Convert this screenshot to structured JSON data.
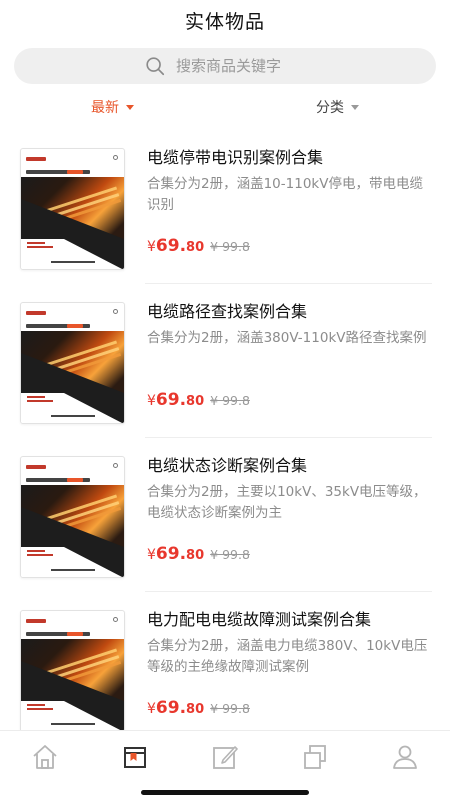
{
  "header": {
    "title": "实体物品"
  },
  "search": {
    "placeholder": "搜索商品关键字"
  },
  "filters": {
    "latest": "最新",
    "category": "分类"
  },
  "products": [
    {
      "title": "电缆停带电识别案例合集",
      "desc": "合集分为2册，涵盖10-110kV停电，带电电缆识别",
      "currency": "¥",
      "price_int": "69.",
      "price_dec": "80",
      "orig": "¥ 99.8"
    },
    {
      "title": "电缆路径查找案例合集",
      "desc": "合集分为2册，涵盖380V-110kV路径查找案例",
      "currency": "¥",
      "price_int": "69.",
      "price_dec": "80",
      "orig": "¥ 99.8"
    },
    {
      "title": "电缆状态诊断案例合集",
      "desc": "合集分为2册，主要以10kV、35kV电压等级，电缆状态诊断案例为主",
      "currency": "¥",
      "price_int": "69.",
      "price_dec": "80",
      "orig": "¥ 99.8"
    },
    {
      "title": "电力配电电缆故障测试案例合集",
      "desc": "合集分为2册，涵盖电力电缆380V、10kV电压等级的主绝缘故障测试案例",
      "currency": "¥",
      "price_int": "69.",
      "price_dec": "80",
      "orig": "¥ 99.8"
    }
  ],
  "tabbar": {
    "icons": [
      "home-icon",
      "shop-icon",
      "edit-icon",
      "copy-icon",
      "profile-icon"
    ],
    "active_index": 1
  },
  "colors": {
    "accent": "#e8552a",
    "price": "#e8372d",
    "inactive_icon": "#b5b5b5",
    "active_icon": "#333333"
  }
}
